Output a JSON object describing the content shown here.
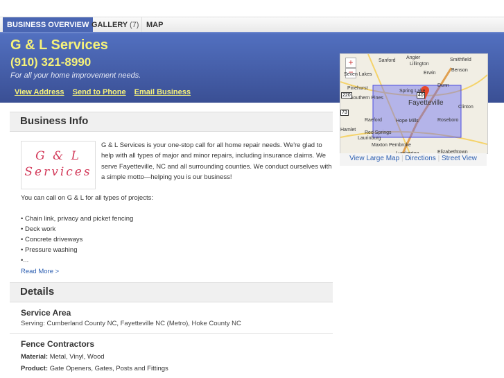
{
  "tabs": [
    {
      "label": "BUSINESS OVERVIEW"
    },
    {
      "label": "GALLERY",
      "count": "(7)"
    },
    {
      "label": "MAP"
    }
  ],
  "business": {
    "name": "G & L Services",
    "phone": "(910) 321-8990",
    "tagline": "For all your home improvement needs.",
    "links": [
      "View Address",
      "Send to Phone",
      "Email Business"
    ],
    "logo_text": "G & L Services"
  },
  "map": {
    "towns": [
      "Angier",
      "Sanford",
      "Lillington",
      "Smithfield",
      "Seven Lakes",
      "Erwin",
      "Benson",
      "Pinehurst",
      "Dunn",
      "Southern Pines",
      "Spring Lake",
      "Fayetteville",
      "Clinton",
      "Raeford",
      "Hope Mills",
      "Roseboro",
      "Hamlet",
      "Red Springs",
      "Laurinburg",
      "Maxton",
      "Pembroke",
      "Lumberton",
      "Elizabethtown"
    ],
    "shields": [
      "220",
      "73",
      "40"
    ],
    "links": [
      "View Large Map",
      "Directions",
      "Street View"
    ]
  },
  "business_info": {
    "heading": "Business Info",
    "description": "G & L Services is your one-stop call for all home repair needs. We're glad to help with all types of major and minor repairs, including insurance claims. We serve Fayetteville, NC and all surrounding counties. We conduct ourselves with a simple motto—helping you is our business!",
    "intro": "You can call on G & L for all types of projects:",
    "projects": [
      "• Chain link, privacy and picket fencing",
      "• Deck work",
      "• Concrete driveways",
      "• Pressure washing",
      "•..."
    ],
    "read_more": "Read More >"
  },
  "details": {
    "heading": "Details",
    "service_area": {
      "title": "Service Area",
      "text": "Serving: Cumberland County NC, Fayetteville NC (Metro), Hoke County NC"
    },
    "fence": {
      "title": "Fence Contractors",
      "material_label": "Material:",
      "material": "Metal, Vinyl, Wood",
      "product_label": "Product:",
      "product": "Gate Openers, Gates, Posts and Fittings"
    }
  }
}
